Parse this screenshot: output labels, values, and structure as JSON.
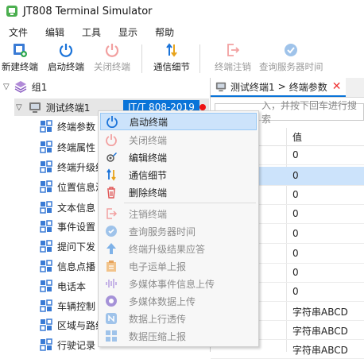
{
  "window": {
    "title": "JT808 Terminal Simulator"
  },
  "menubar": [
    "文件",
    "编辑",
    "工具",
    "显示",
    "帮助"
  ],
  "toolbar": {
    "new_terminal": "新建终端",
    "start_terminal": "启动终端",
    "close_terminal": "关闭终端",
    "comm_detail": "通信细节",
    "logout_terminal": "终端注销",
    "query_server_time": "查询服务器时间"
  },
  "tree": {
    "group": "组1",
    "terminal": "测试终端1",
    "protocol_badge": "JT/T 808-2019",
    "items": [
      "终端参数",
      "终端属性",
      "终端升级结",
      "位置信息汇",
      "文本信息",
      "事件设置",
      "提问下发",
      "信息点播",
      "电话本",
      "车辆控制",
      "区域与路线",
      "行驶记录"
    ]
  },
  "tab": {
    "breadcrumb_terminal": "测试终端1",
    "breadcrumb_sep": ">",
    "breadcrumb_page": "终端参数",
    "close": "✕"
  },
  "filter": {
    "text": "入，并按下回车进行搜索"
  },
  "table": {
    "value_header": "值",
    "rows": [
      "0",
      "0",
      "0",
      "0",
      "0",
      "0",
      "0",
      "0",
      "字符串ABCD",
      "字符串ABCD",
      "字符串ABCD"
    ]
  },
  "context_menu": {
    "items": [
      {
        "label": "启动终端",
        "state": "hover"
      },
      {
        "label": "关闭终端",
        "state": "disabled"
      },
      {
        "label": "编辑终端",
        "state": "normal"
      },
      {
        "label": "通信细节",
        "state": "normal"
      },
      {
        "label": "删除终端",
        "state": "normal"
      },
      {
        "label": "注销终端",
        "state": "disabled"
      },
      {
        "label": "查询服务器时间",
        "state": "disabled"
      },
      {
        "label": "终端升级结果应答",
        "state": "disabled"
      },
      {
        "label": "电子运单上报",
        "state": "disabled"
      },
      {
        "label": "多媒体事件信息上传",
        "state": "disabled"
      },
      {
        "label": "多媒体数据上传",
        "state": "disabled"
      },
      {
        "label": "数据上行透传",
        "state": "disabled"
      },
      {
        "label": "数据压缩上报",
        "state": "disabled"
      }
    ]
  },
  "colors": {
    "accent": "#0a74d8",
    "selection": "#cce3fb",
    "danger": "#e11111"
  }
}
